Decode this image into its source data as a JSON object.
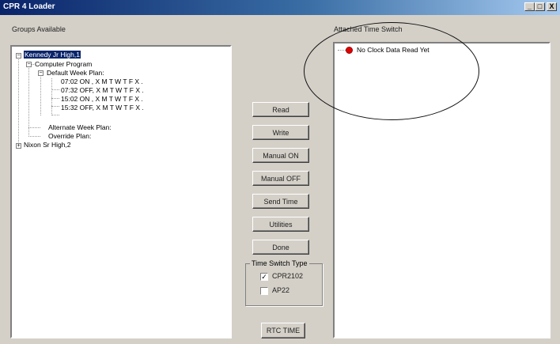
{
  "window": {
    "title": "CPR 4 Loader"
  },
  "title_buttons": {
    "minimize": "_",
    "maximize": "□",
    "close": "X"
  },
  "groups": {
    "label": "Groups Available",
    "tree": {
      "kennedy": "Kennedy Jr High,1",
      "computer_program": "Computer Program",
      "default_week_plan": "Default Week Plan:",
      "entries": [
        "07:02 ON , X M T W T F X .",
        "07:32 OFF, X M T W T F X .",
        "15:02 ON , X M T W T F X .",
        "15:32 OFF, X M T W T F X ."
      ],
      "alternate_week_plan": "Alternate Week Plan:",
      "override_plan": "Override Plan:",
      "nixon": "Nixon Sr High,2"
    }
  },
  "buttons": {
    "read": "Read",
    "write": "Write",
    "manual_on": "Manual ON",
    "manual_off": "Manual OFF",
    "send_time": "Send Time",
    "utilities": "Utilities",
    "done": "Done",
    "rtc_time": "RTC TIME"
  },
  "time_switch_type": {
    "legend": "Time Switch Type",
    "options": [
      {
        "label": "CPR2102",
        "checked": true
      },
      {
        "label": "AP22",
        "checked": false
      }
    ]
  },
  "attached": {
    "label": "Attached Time Switch",
    "status": "No Clock Data Read Yet",
    "status_color": "#e00000"
  },
  "expander_symbols": {
    "expanded": "−",
    "collapsed": "+"
  },
  "check_mark": "✓"
}
